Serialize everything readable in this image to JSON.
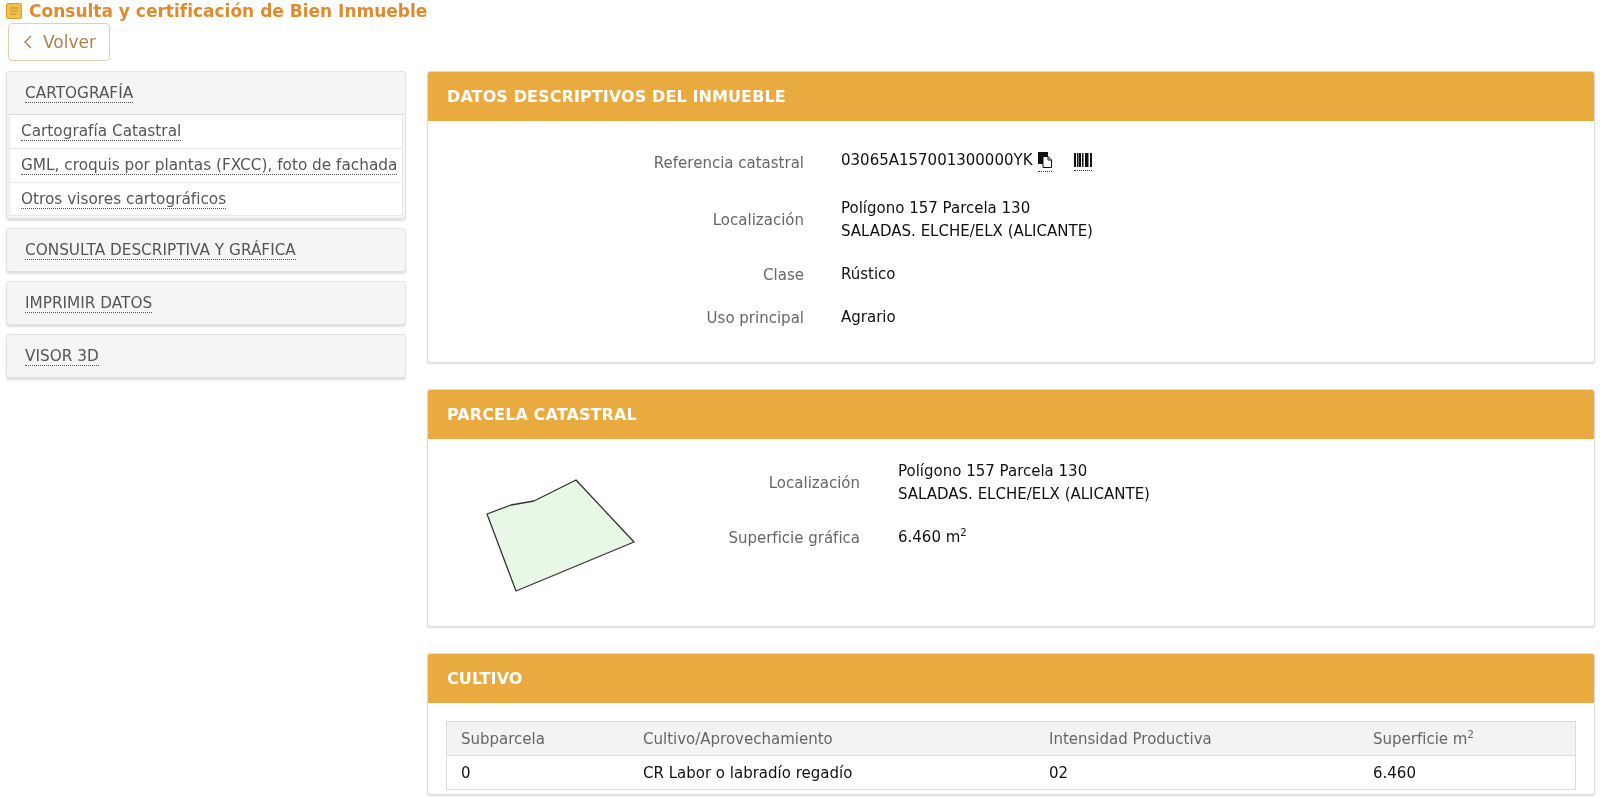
{
  "page": {
    "title": "Consulta y certificación de Bien Inmueble",
    "back_button": "Volver"
  },
  "sidebar": {
    "sections": [
      {
        "title": "CARTOGRAFÍA",
        "expanded": true,
        "items": [
          "Cartografía Catastral",
          "GML, croquis por plantas (FXCC), foto de fachada",
          "Otros visores cartográficos"
        ]
      },
      {
        "title": "CONSULTA DESCRIPTIVA Y GRÁFICA",
        "expanded": false
      },
      {
        "title": "IMPRIMIR DATOS",
        "expanded": false
      },
      {
        "title": "VISOR 3D",
        "expanded": false
      }
    ]
  },
  "cards": [
    {
      "kind": "fields",
      "title": "DATOS DESCRIPTIVOS DEL INMUEBLE",
      "fields": [
        {
          "kind": "reference",
          "label": "Referencia catastral",
          "lines": [
            "03065A157001300000YK"
          ]
        },
        {
          "kind": "text",
          "label": "Localización",
          "lines": [
            "Polígono 157 Parcela 130",
            "SALADAS. ELCHE/ELX (ALICANTE)"
          ]
        },
        {
          "kind": "text",
          "label": "Clase",
          "lines": [
            "Rústico"
          ]
        },
        {
          "kind": "text",
          "label": "Uso principal",
          "lines": [
            "Agrario"
          ]
        }
      ]
    },
    {
      "kind": "parcel",
      "title": "PARCELA CATASTRAL",
      "fields": [
        {
          "kind": "text",
          "label": "Localización",
          "lines": [
            "Polígono 157 Parcela 130",
            "SALADAS. ELCHE/ELX (ALICANTE)"
          ]
        },
        {
          "kind": "text",
          "label": "Superficie gráfica",
          "lines": [
            "6.460 m$^{2}$"
          ]
        }
      ]
    },
    {
      "kind": "table",
      "title": "CULTIVO",
      "table": {
        "columns": [
          "Subparcela",
          "Cultivo/Aprovechamiento",
          "Intensidad Productiva",
          "Superficie m$^{2}$"
        ],
        "rows": [
          [
            "0",
            "CR Labor o labradío regadío",
            "02",
            "6.460"
          ]
        ]
      }
    }
  ]
}
